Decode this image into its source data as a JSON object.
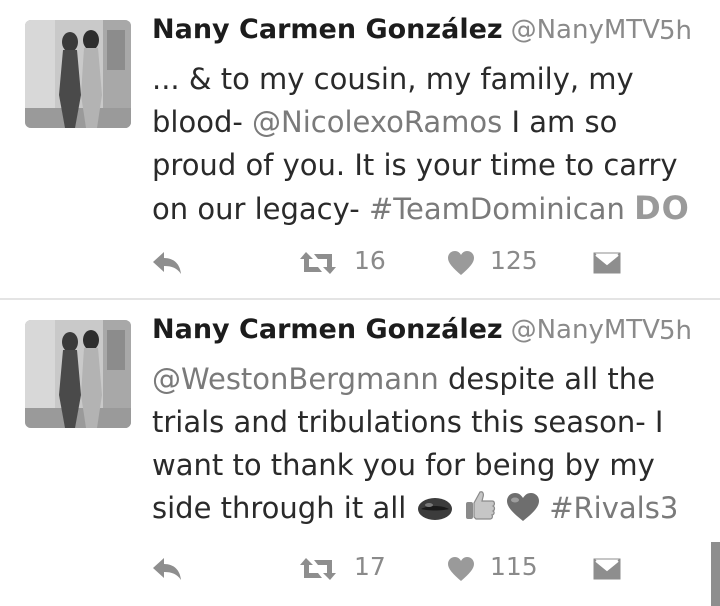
{
  "tweets": [
    {
      "name": "Nany Carmen González",
      "handle": "@NanyMTV",
      "time": "5h",
      "lines": {
        "l1": "... & to my cousin, my family, my",
        "l2a": "blood- ",
        "l2b": "@NicolexoRamos",
        "l2c": " I am so",
        "l3": "proud of you. It is your time to carry",
        "l4a": "on our legacy- ",
        "l4b": "#TeamDominican",
        "l4c": "DO"
      },
      "retweets": "16",
      "likes": "125"
    },
    {
      "name": "Nany Carmen González",
      "handle": "@NanyMTV",
      "time": "5h",
      "lines": {
        "l1a": "@WestonBergmann",
        "l1b": " despite all the",
        "l2": "trials and tribulations this season- I",
        "l3": "want to thank you for being by my",
        "l4a": "side through it all ",
        "l4b": "#Rivals3"
      },
      "retweets": "17",
      "likes": "115"
    }
  ],
  "icons": {
    "reply": "reply-icon",
    "retweet": "retweet-icon",
    "like": "heart-icon",
    "message": "direct-message-icon",
    "lips_emoji": "lips-emoji-icon",
    "thumbs_up_emoji": "thumbs-up-emoji-icon",
    "heart_emoji": "heart-emoji-icon"
  },
  "colors": {
    "text": "#2a2a2a",
    "secondary": "#8a8a8a",
    "background": "#ffffff"
  }
}
